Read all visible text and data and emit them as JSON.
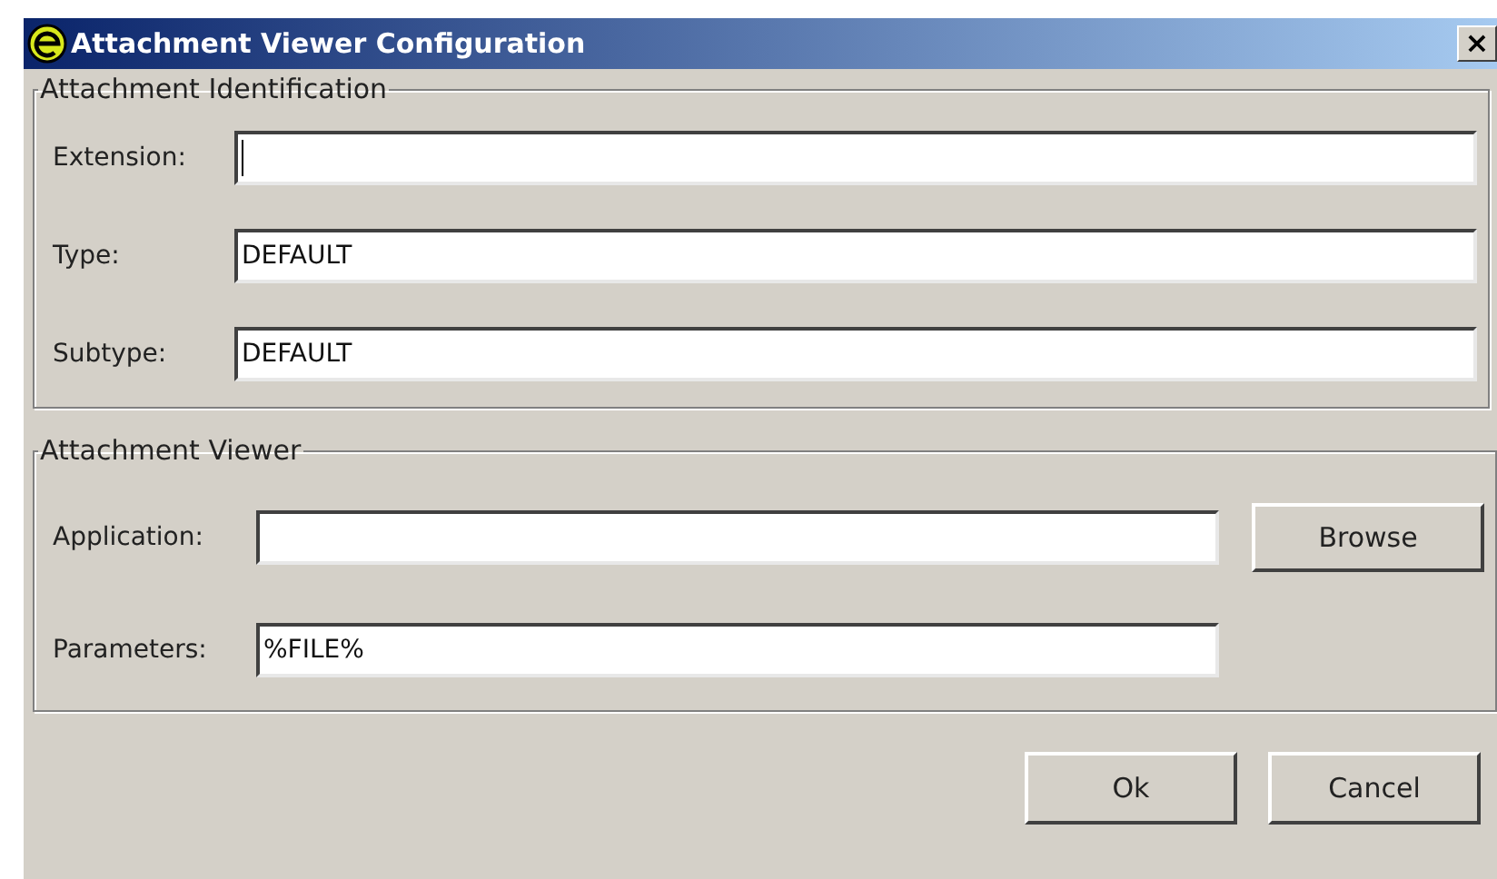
{
  "window": {
    "title": "Attachment Viewer Configuration",
    "close": "×"
  },
  "identification": {
    "legend": "Attachment Identification",
    "fields": [
      {
        "label": "Extension:",
        "focused": true
      },
      {
        "label": "Type:",
        "value": "DEFAULT",
        "focused": false
      },
      {
        "label": "Subtype:",
        "value": "DEFAULT",
        "focused": false
      }
    ]
  },
  "viewer": {
    "legend": "Attachment Viewer",
    "fields": [
      {
        "label": "Application:",
        "focused": false,
        "button": "Browse"
      },
      {
        "label": "Parameters:",
        "value": "%FILE%",
        "focused": false
      }
    ]
  },
  "buttons": [
    "Ok",
    "Cancel"
  ]
}
